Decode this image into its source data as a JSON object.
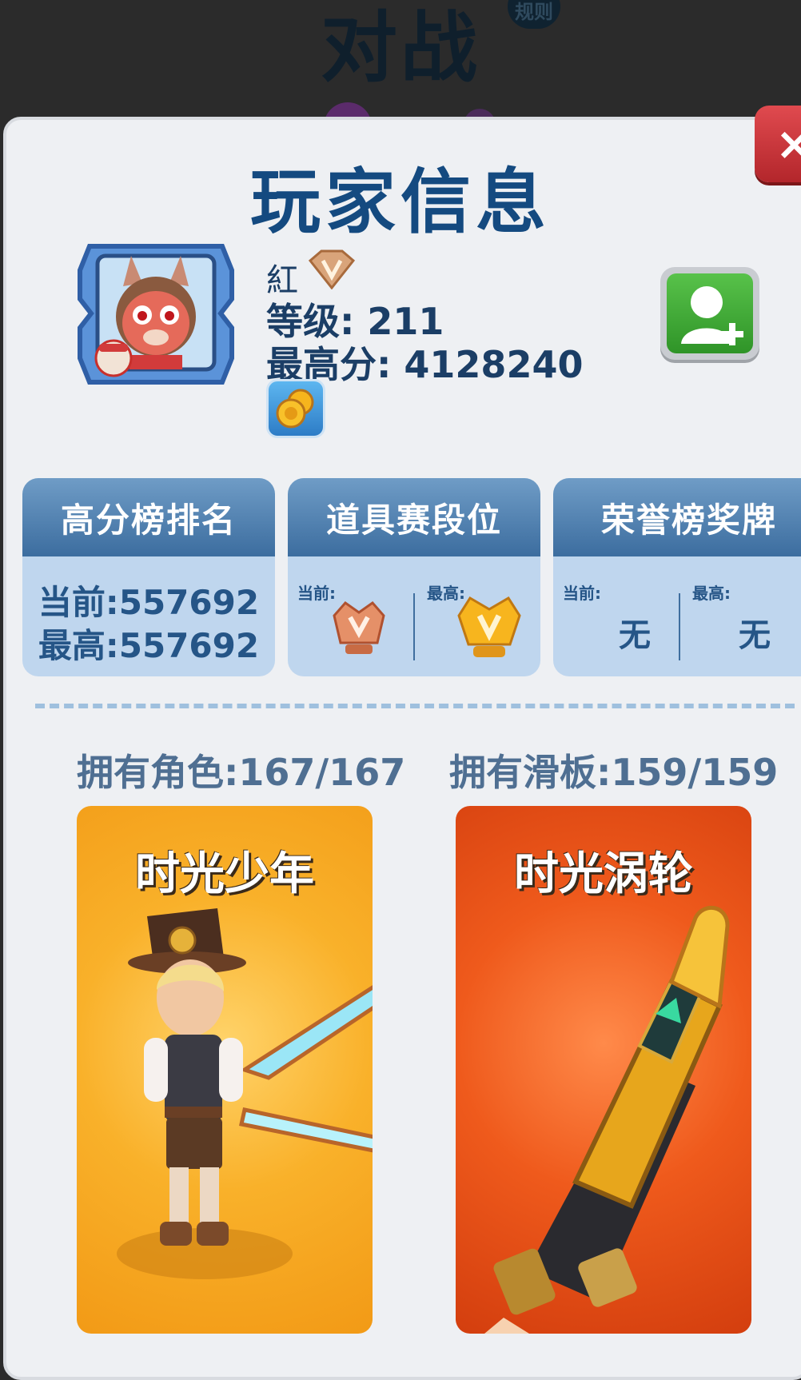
{
  "background": {
    "screen_title": "对战",
    "rules_badge": "规则"
  },
  "dialog": {
    "title": "玩家信息",
    "close_label": "×"
  },
  "player": {
    "name": "紅",
    "level": "等级: 211",
    "high_score": "最高分: 4128240"
  },
  "stats": {
    "leaderboard": {
      "title": "高分榜排名",
      "current": "当前:557692",
      "best": "最高:557692"
    },
    "item_tier": {
      "title": "道具赛段位",
      "current_label": "当前:",
      "best_label": "最高:"
    },
    "honor_medal": {
      "title": "荣誉榜奖牌",
      "current_label": "当前:",
      "best_label": "最高:",
      "current_value": "无",
      "best_value": "无"
    }
  },
  "collection": {
    "characters_owned": "拥有角色:167/167",
    "boards_owned": "拥有滑板:159/159",
    "character_name": "时光少年",
    "board_name": "时光涡轮"
  },
  "colors": {
    "title_blue": "#144a80",
    "stat_header": "#4a7aaa",
    "stat_body": "#bfd6ee",
    "character_card": "#f7a722",
    "board_card": "#e24a12",
    "add_friend": "#3fa836",
    "close_red": "#cc3136"
  },
  "icons": [
    "close-icon",
    "add-friend-icon",
    "coin-icon",
    "rank-badge-icon",
    "bronze-trophy-icon",
    "gold-trophy-icon"
  ]
}
